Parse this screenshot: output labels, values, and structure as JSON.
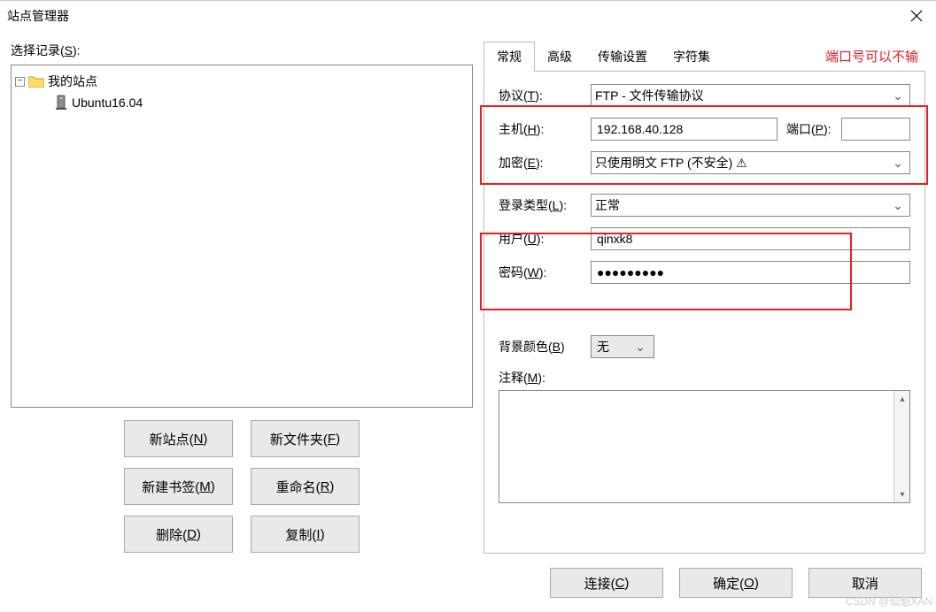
{
  "window": {
    "title": "站点管理器"
  },
  "left": {
    "label_prefix": "选择记录(",
    "label_key": "S",
    "label_suffix": "):",
    "tree": {
      "root": "我的站点",
      "child": "Ubuntu16.04"
    },
    "buttons": {
      "new_site": "新站点(",
      "new_site_key": "N",
      "new_folder": "新文件夹(",
      "new_folder_key": "F",
      "new_bookmark": "新建书签(",
      "new_bookmark_key": "M",
      "rename": "重命名(",
      "rename_key": "R",
      "delete": "删除(",
      "delete_key": "D",
      "copy": "复制(",
      "copy_key": "I",
      "close_paren": ")"
    }
  },
  "tabs": {
    "general": "常规",
    "advanced": "高级",
    "transfer": "传输设置",
    "charset": "字符集"
  },
  "form": {
    "protocol_label": "协议(",
    "protocol_key": "T",
    "protocol_suffix": "):",
    "protocol_value": "FTP - 文件传输协议",
    "host_label": "主机(",
    "host_key": "H",
    "host_suffix": "):",
    "host_value": "192.168.40.128",
    "port_label": "端口(",
    "port_key": "P",
    "port_suffix": "):",
    "port_value": "",
    "encrypt_label": "加密(",
    "encrypt_key": "E",
    "encrypt_suffix": "):",
    "encrypt_value": "只使用明文 FTP (不安全) ⚠",
    "logon_label": "登录类型(",
    "logon_key": "L",
    "logon_suffix": "):",
    "logon_value": "正常",
    "user_label": "用户(",
    "user_key": "U",
    "user_suffix": "):",
    "user_value": "qinxk8",
    "pass_label": "密码(",
    "pass_key": "W",
    "pass_suffix": "):",
    "pass_value": "●●●●●●●●●",
    "bg_label": "背景颜色(",
    "bg_key": "B",
    "bg_suffix": ")",
    "bg_value": "无",
    "memo_label": "注释(",
    "memo_key": "M",
    "memo_suffix": "):"
  },
  "annotation": "端口号可以不输",
  "footer": {
    "connect": "连接(",
    "connect_key": "C",
    "ok": "确定(",
    "ok_key": "O",
    "cancel": "取消",
    "close_paren": ")"
  },
  "watermark": "CSDN @仙魁XAN"
}
